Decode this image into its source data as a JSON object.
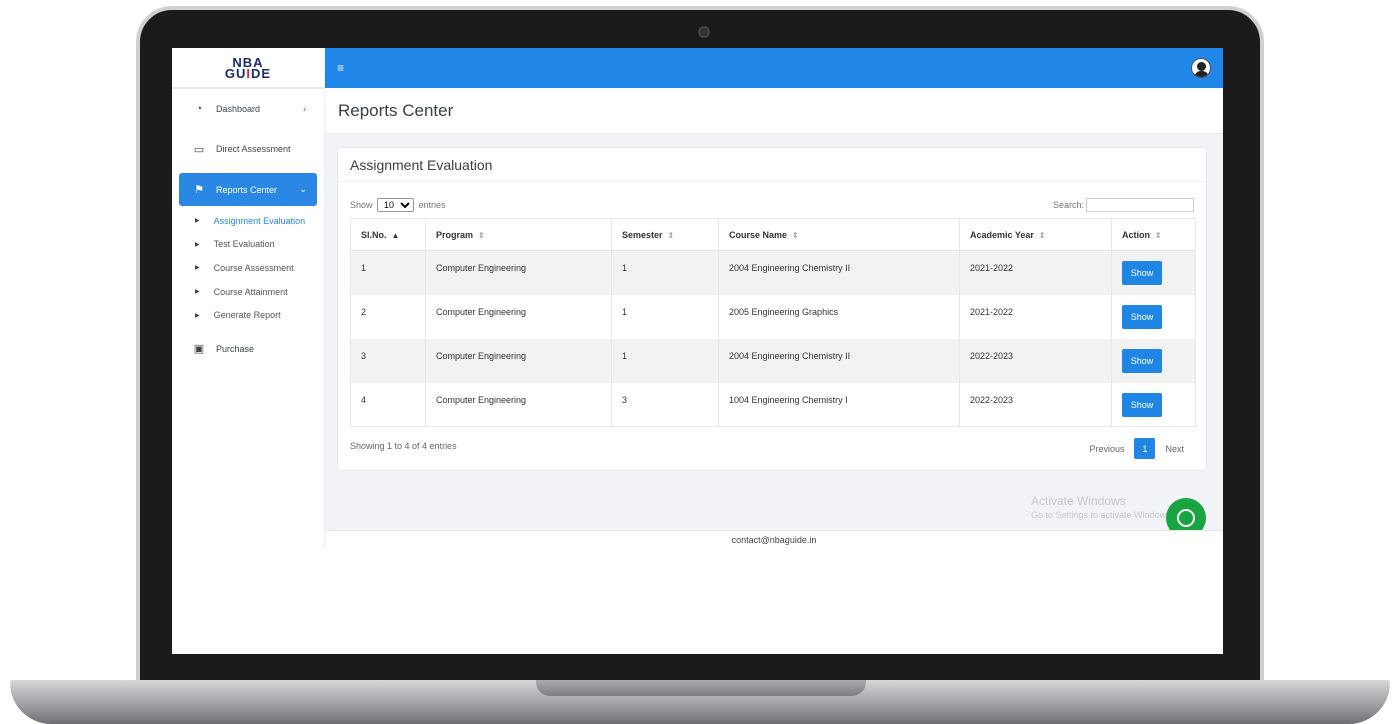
{
  "brand": {
    "line1": "NBA",
    "line2_a": "GU",
    "line2_b": "I",
    "line2_c": "DE"
  },
  "sidebar": {
    "items": [
      {
        "label": "Dashboard",
        "icon": "dashboard-icon"
      },
      {
        "label": "Direct Assessment",
        "icon": "id-card-icon"
      },
      {
        "label": "Reports Center",
        "icon": "flag-icon"
      },
      {
        "label": "Purchase",
        "icon": "money-icon"
      }
    ],
    "sub": [
      "Assignment Evaluation",
      "Test Evaluation",
      "Course Assessment",
      "Course Attainment",
      "Generate Report"
    ]
  },
  "header": {
    "menu_icon": "≡"
  },
  "page": {
    "title": "Reports Center"
  },
  "card": {
    "title": "Assignment Evaluation",
    "show_label": "Show",
    "entries_label": "entries",
    "page_size": "10",
    "search_label": "Search:",
    "columns": [
      "Sl.No.",
      "Program",
      "Semester",
      "Course Name",
      "Academic Year",
      "Action"
    ],
    "rows": [
      [
        "1",
        "Computer Engineering",
        "1",
        "2004 Engineering Chemistry II",
        "2021-2022",
        "Show"
      ],
      [
        "2",
        "Computer Engineering",
        "1",
        "2005 Engineering Graphics",
        "2021-2022",
        "Show"
      ],
      [
        "3",
        "Computer Engineering",
        "1",
        "2004 Engineering Chemistry II",
        "2022-2023",
        "Show"
      ],
      [
        "4",
        "Computer Engineering",
        "3",
        "1004 Engineering Chemistry I",
        "2022-2023",
        "Show"
      ]
    ],
    "info": "Showing 1 to 4 of 4 entries",
    "pager": {
      "prev": "Previous",
      "current": "1",
      "next": "Next"
    }
  },
  "overlay": {
    "activate_title": "Activate Windows",
    "activate_sub": "Go to Settings to activate Windows."
  },
  "footer": {
    "contact": "contact@nbaguide.in"
  },
  "colors": {
    "primary": "#2087e8",
    "chat": "#19a442"
  }
}
